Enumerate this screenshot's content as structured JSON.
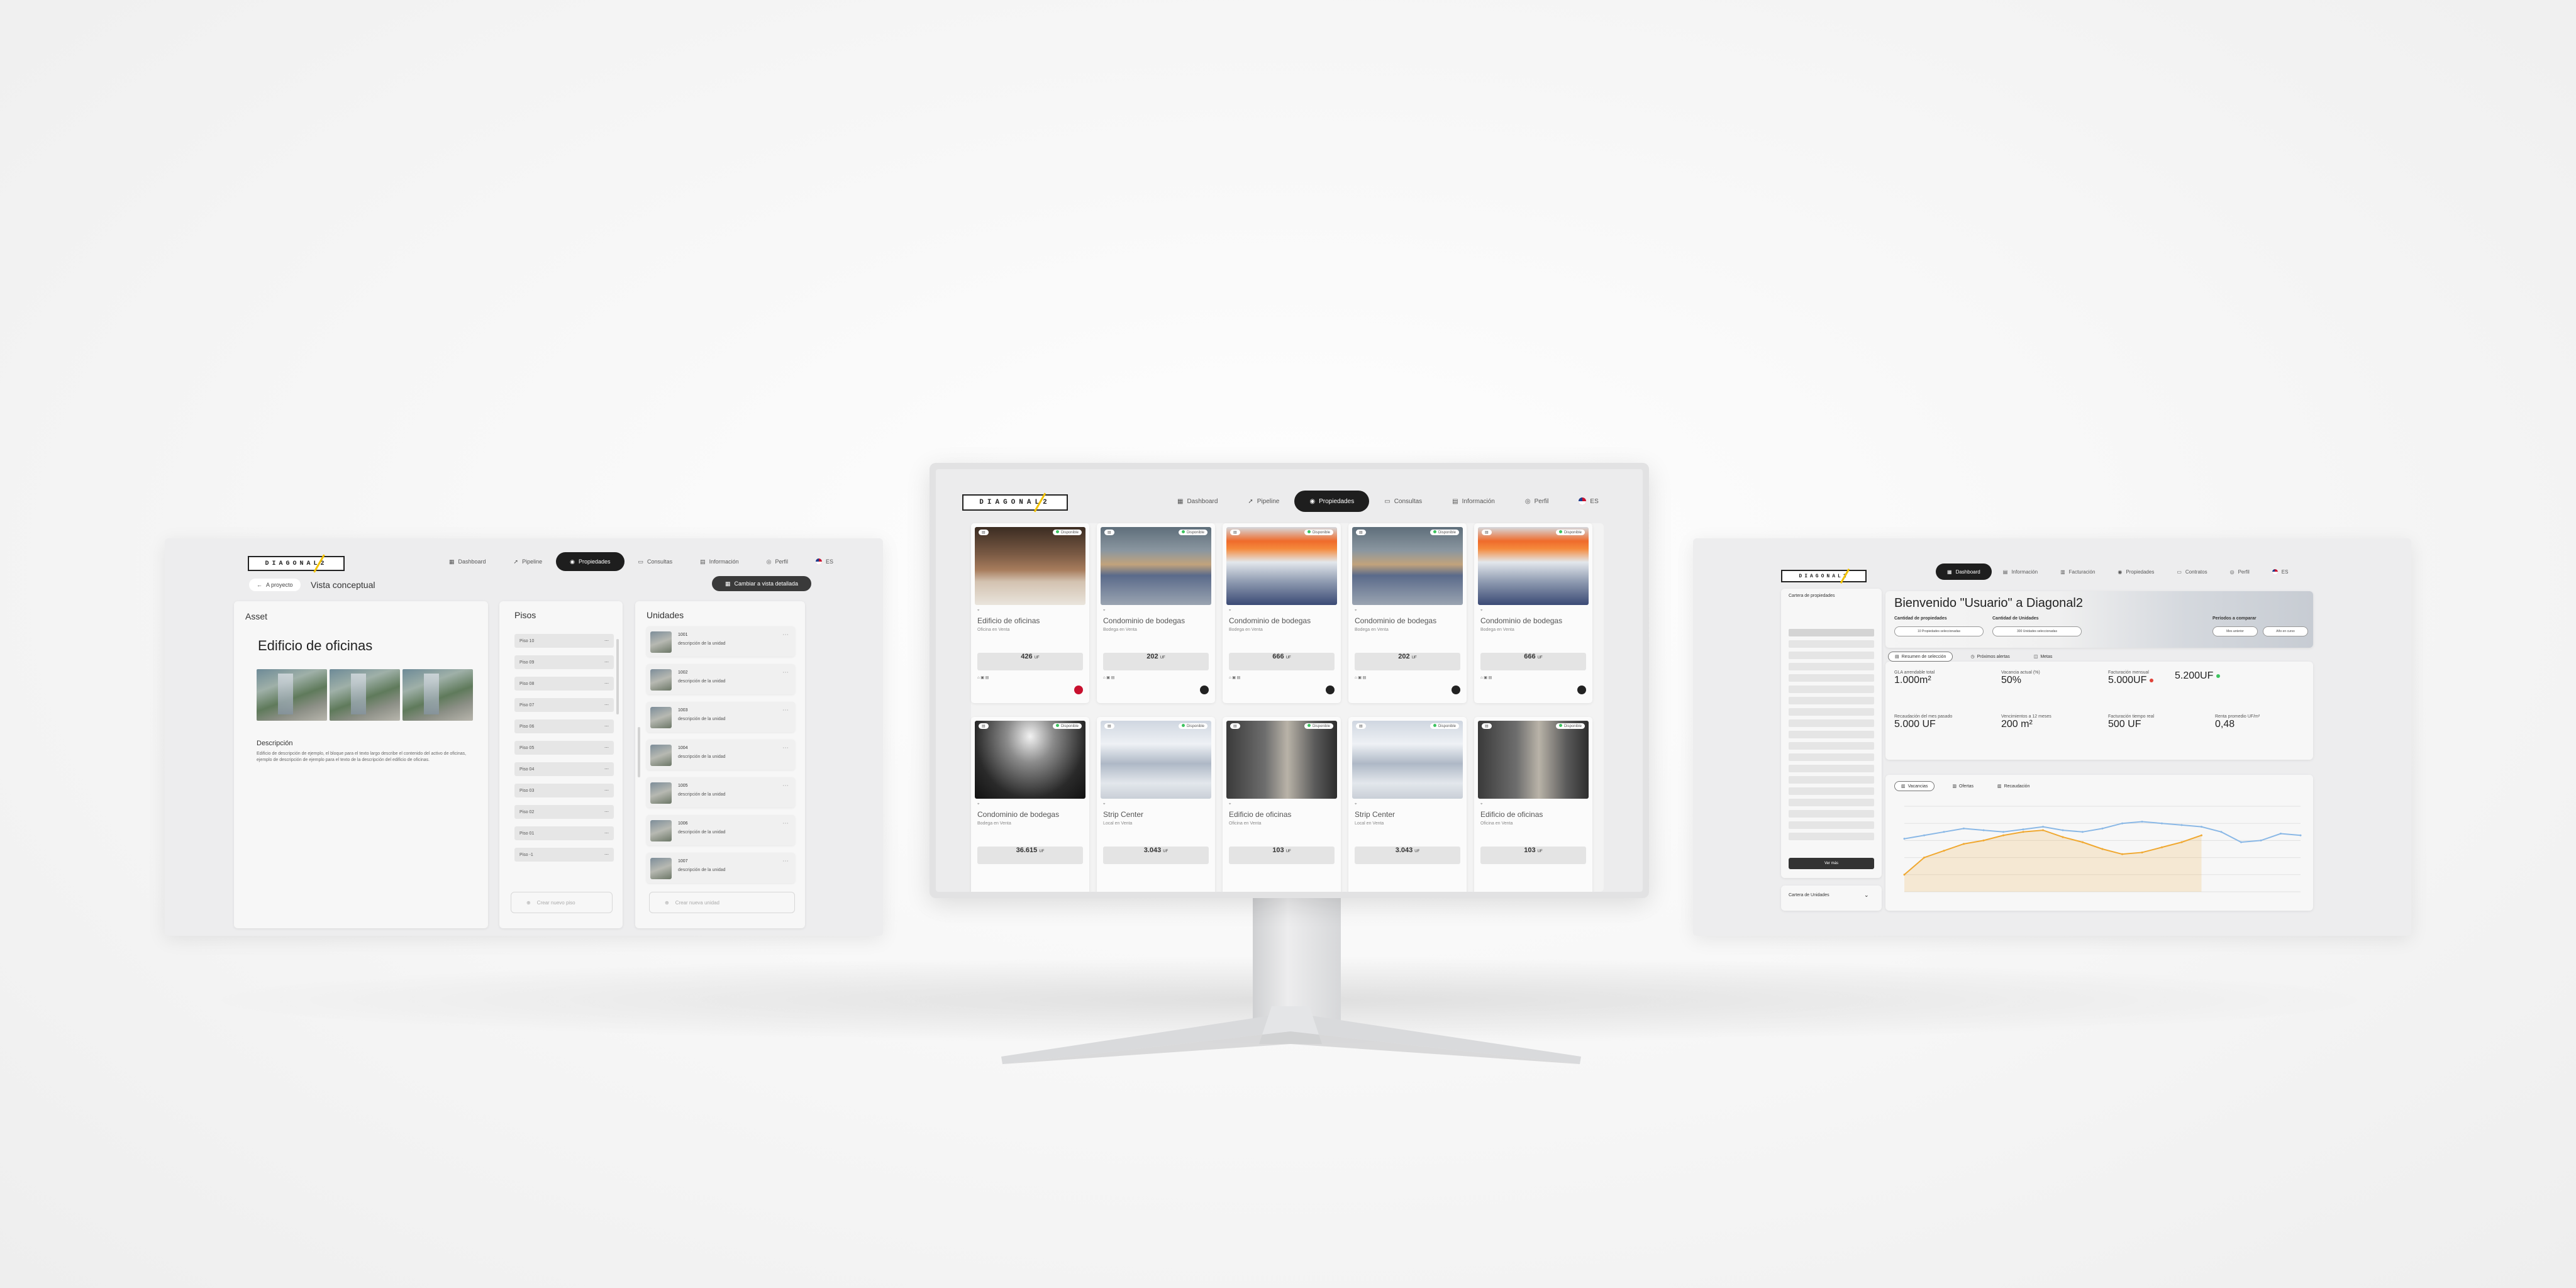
{
  "brand": {
    "logo_text": "DIAGONAL2",
    "accent": "#f2c200"
  },
  "nav": {
    "dashboard": "Dashboard",
    "pipeline": "Pipeline",
    "propiedades": "Propiedades",
    "consultas": "Consultas",
    "informacion": "Información",
    "perfil": "Perfil",
    "facturacion": "Facturación",
    "contratos": "Contratos",
    "language": "ES"
  },
  "left": {
    "back_label": "A proyecto",
    "view_title": "Vista conceptual",
    "switch_label": "Cambiar a vista detallada",
    "asset": {
      "section_title": "Asset",
      "name": "Edificio de oficinas",
      "description_title": "Descripción",
      "description_text": "Edificio de descripción de ejemplo, el bloque para el texto largo describe el contenido del activo de oficinas, ejemplo de descripción de ejemplo para el texto de la descripción del edificio de oficinas."
    },
    "pisos": {
      "section_title": "Pisos",
      "items": [
        "Piso 10",
        "Piso 09",
        "Piso 08",
        "Piso 07",
        "Piso 06",
        "Piso 05",
        "Piso 04",
        "Piso 03",
        "Piso 02",
        "Piso 01",
        "Piso -1"
      ],
      "add_label": "Crear nuevo piso"
    },
    "unidades": {
      "section_title": "Unidades",
      "items": [
        {
          "name": "1001",
          "desc": "descripción de la unidad"
        },
        {
          "name": "1002",
          "desc": "descripción de la unidad"
        },
        {
          "name": "1003",
          "desc": "descripción de la unidad"
        },
        {
          "name": "1004",
          "desc": "descripción de la unidad"
        },
        {
          "name": "1005",
          "desc": "descripción de la unidad"
        },
        {
          "name": "1006",
          "desc": "descripción de la unidad"
        },
        {
          "name": "1007",
          "desc": "descripción de la unidad"
        }
      ],
      "add_label": "Crear nueva unidad"
    }
  },
  "properties": [
    {
      "title": "Edificio de oficinas",
      "subtitle": "Oficina en Venta",
      "price": "426",
      "unit": "UF",
      "status": "Disponible"
    },
    {
      "title": "Condominio de bodegas",
      "subtitle": "Bodega en Venta",
      "price": "202",
      "unit": "UF",
      "status": "Disponible"
    },
    {
      "title": "Condominio de bodegas",
      "subtitle": "Bodega en Venta",
      "price": "666",
      "unit": "UF",
      "status": "Disponible"
    },
    {
      "title": "Condominio de bodegas",
      "subtitle": "Bodega en Venta",
      "price": "202",
      "unit": "UF",
      "status": "Disponible"
    },
    {
      "title": "Condominio de bodegas",
      "subtitle": "Bodega en Venta",
      "price": "666",
      "unit": "UF",
      "status": "Disponible"
    },
    {
      "title": "Condominio de bodegas",
      "subtitle": "Bodega en Venta",
      "price": "36.615",
      "unit": "UF",
      "status": "Disponible"
    },
    {
      "title": "Strip Center",
      "subtitle": "Local en Venta",
      "price": "3.043",
      "unit": "UF",
      "status": "Disponible"
    },
    {
      "title": "Edificio de oficinas",
      "subtitle": "Oficina en Venta",
      "price": "103",
      "unit": "UF",
      "status": "Disponible"
    },
    {
      "title": "Strip Center",
      "subtitle": "Local en Venta",
      "price": "3.043",
      "unit": "UF",
      "status": "Disponible"
    },
    {
      "title": "Edificio de oficinas",
      "subtitle": "Oficina en Venta",
      "price": "103",
      "unit": "UF",
      "status": "Disponible"
    }
  ],
  "right": {
    "greeting": "Bienvenido \"Usuario\" a Diagonal2",
    "sidebar_title": "Cartera de propiedades",
    "sidebar_button": "Ver más",
    "sidebar_bottom": "Cartera de Unidades",
    "hero_labels": [
      "Cantidad de propiedades",
      "Cantidad de Unidades",
      "Períodos a comparar"
    ],
    "hero_pills": [
      "10 Propiedades seleccionadas",
      "300 Unidades seleccionadas",
      "Mes anterior",
      "Año en curso"
    ],
    "tabs": [
      "Resumen de selección",
      "Próximos alertas",
      "Metas"
    ],
    "kpis": [
      {
        "label": "GLA arrendable total",
        "value": "1.000m²"
      },
      {
        "label": "Vacancia actual (%)",
        "value": "50%"
      },
      {
        "label": "Facturación mensual",
        "value": "5.000UF"
      },
      {
        "label": "",
        "value": "5.200UF"
      },
      {
        "label": "Recaudación del mes pasado",
        "value": "5.000 UF"
      },
      {
        "label": "Vencimientos a 12 meses",
        "value": "200 m²"
      },
      {
        "label": "Facturación tiempo real",
        "value": "500 UF"
      },
      {
        "label": "Renta promedio UF/m²",
        "value": "0,48"
      }
    ],
    "chart_tabs": [
      "Vacancias",
      "Ofertas",
      "Recaudación"
    ]
  },
  "chart_data": {
    "type": "line",
    "title": "",
    "xlabel": "",
    "ylabel": "",
    "series": [
      {
        "name": "",
        "color": "#8ab8e6",
        "values": [
          62,
          66,
          70,
          74,
          72,
          70,
          73,
          76,
          72,
          70,
          74,
          80,
          82,
          80,
          78,
          76,
          70,
          58,
          60,
          68,
          66
        ]
      },
      {
        "name": "",
        "color": "#f0a830",
        "values": [
          20,
          40,
          48,
          56,
          60,
          66,
          70,
          72,
          64,
          58,
          50,
          44,
          46,
          52,
          58,
          66
        ]
      }
    ]
  }
}
